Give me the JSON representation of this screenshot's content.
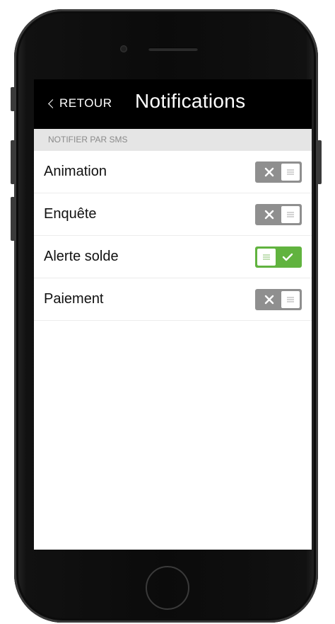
{
  "nav": {
    "back_label": "RETOUR",
    "title": "Notifications"
  },
  "section": {
    "header": "NOTIFIER PAR SMS"
  },
  "settings": [
    {
      "label": "Animation",
      "enabled": false
    },
    {
      "label": "Enquête",
      "enabled": false
    },
    {
      "label": "Alerte solde",
      "enabled": true
    },
    {
      "label": "Paiement",
      "enabled": false
    }
  ],
  "colors": {
    "toggle_on": "#61b33f",
    "toggle_off": "#8f8f8f",
    "nav_background": "#000000",
    "section_background": "#e5e5e5"
  },
  "icons": {
    "back": "chevron-left-icon",
    "off": "close-icon",
    "on": "checkmark-icon",
    "knob": "menu-lines-icon"
  }
}
